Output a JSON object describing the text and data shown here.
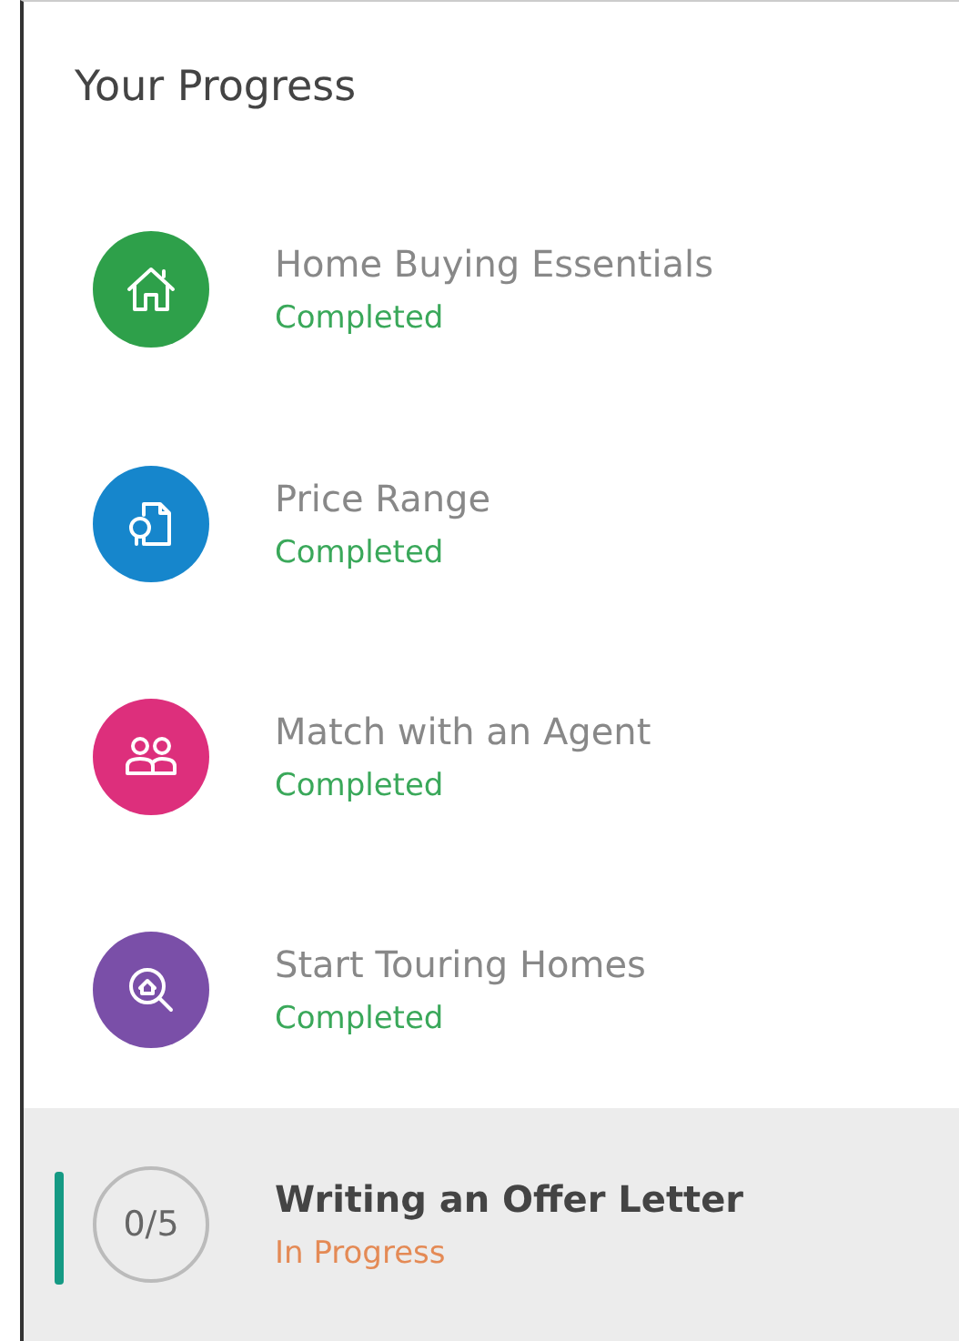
{
  "title": "Your Progress",
  "steps": [
    {
      "kind": "icon",
      "color": "#2ea04a",
      "name": "Home Buying Essentials",
      "status": "Completed",
      "completed": true,
      "selected": false
    },
    {
      "kind": "icon",
      "color": "#1686cc",
      "name": "Price Range",
      "status": "Completed",
      "completed": true,
      "selected": false
    },
    {
      "kind": "icon",
      "color": "#dd2f7c",
      "name": "Match with an Agent",
      "status": "Completed",
      "completed": true,
      "selected": false
    },
    {
      "kind": "icon",
      "color": "#7a4fa8",
      "name": "Start Touring Homes",
      "status": "Completed",
      "completed": true,
      "selected": false
    },
    {
      "kind": "counter",
      "counter": "0/5",
      "name": "Writing an Offer Letter",
      "status": "In Progress",
      "completed": false,
      "selected": true
    }
  ]
}
